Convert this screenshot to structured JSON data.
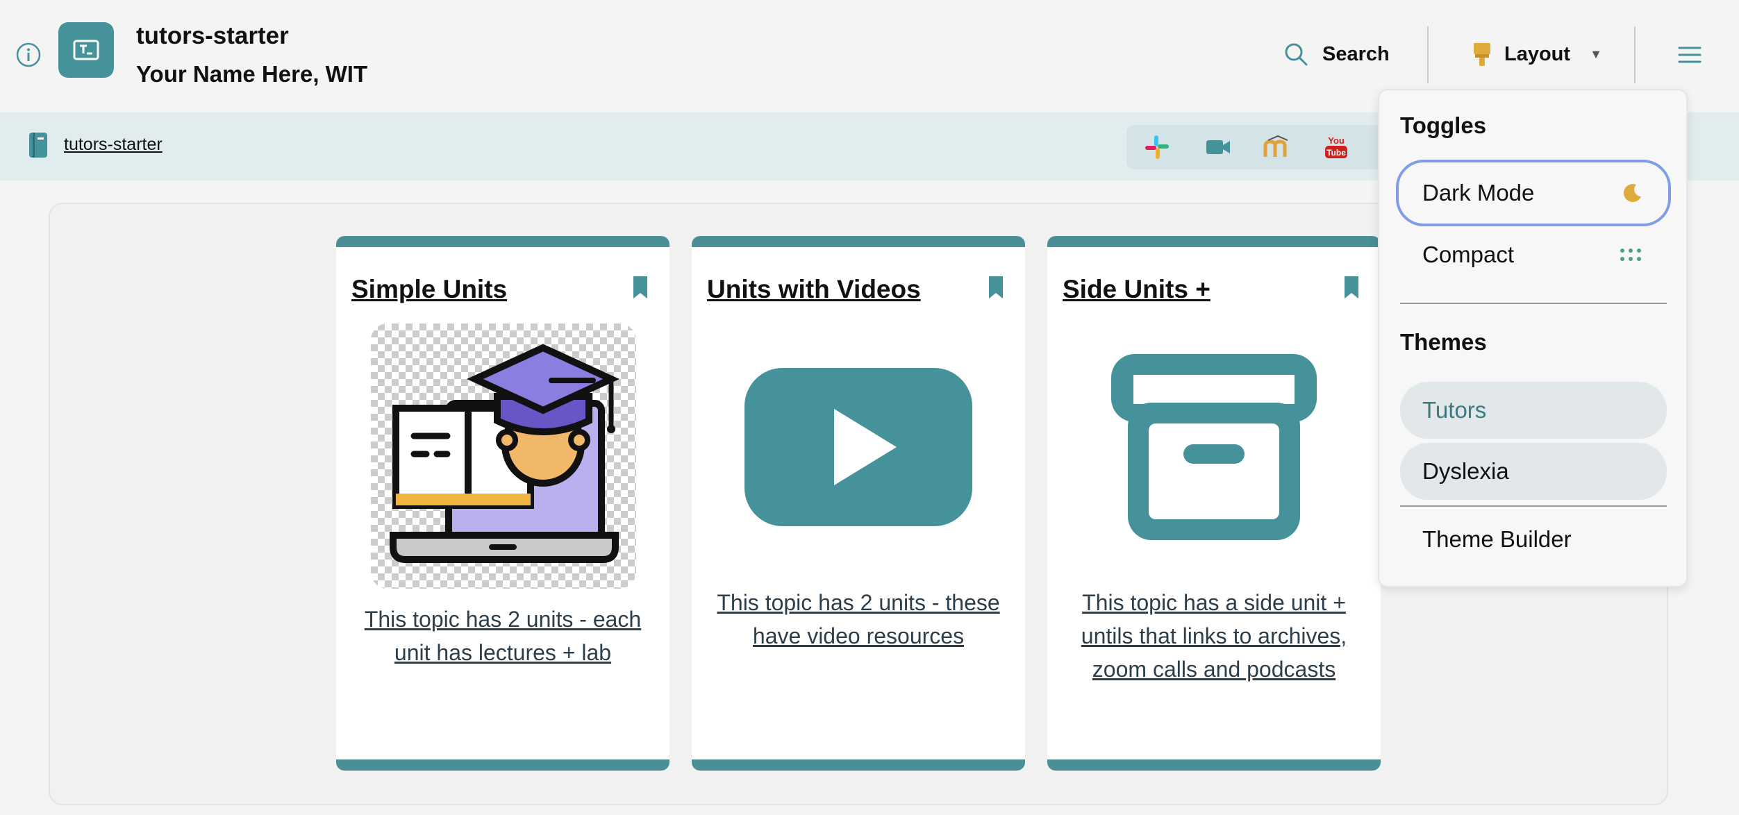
{
  "header": {
    "title": "tutors-starter",
    "subtitle": "Your Name Here, WIT",
    "search_label": "Search",
    "layout_label": "Layout",
    "layout_caret": "▼"
  },
  "subbar": {
    "course_link": "tutors-starter",
    "companions": [
      "slack-icon",
      "video-icon",
      "moodle-icon",
      "youtube-icon"
    ]
  },
  "cards": [
    {
      "title": "Simple Units",
      "description": "This topic has 2 units - each unit has lectures + lab",
      "image": "graduate-laptop-icon"
    },
    {
      "title": "Units with Videos",
      "description": "This topic has 2 units - these have video resources",
      "image": "youtube-play-icon"
    },
    {
      "title": "Side Units +",
      "description": "This topic has a side unit + untils that links to archives, zoom calls and podcasts",
      "image": "archive-box-icon"
    }
  ],
  "layout_menu": {
    "toggles_heading": "Toggles",
    "toggles": [
      {
        "label": "Dark Mode",
        "icon": "moon-icon"
      },
      {
        "label": "Compact",
        "icon": "dots-grid-icon"
      }
    ],
    "themes_heading": "Themes",
    "themes": [
      {
        "label": "Tutors",
        "active": true
      },
      {
        "label": "Dyslexia",
        "active": false
      }
    ],
    "theme_builder": "Theme Builder"
  },
  "colors": {
    "accent": "#46929a",
    "focus_ring": "#7f9de8",
    "subbar_bg": "#e1ecee"
  }
}
